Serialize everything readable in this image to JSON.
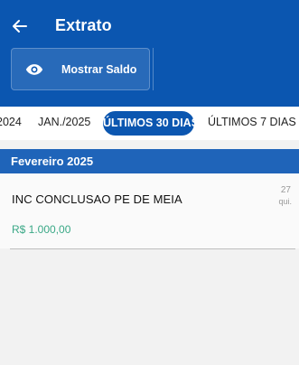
{
  "header": {
    "title": "Extrato",
    "back_icon": "arrow-left-icon",
    "background": "#0b56b0"
  },
  "saldo": {
    "label": "Mostrar Saldo",
    "icon": "eye-icon"
  },
  "period_tabs": {
    "items": [
      "2024",
      "JAN./2025",
      "ÚLTIMOS 30 DIAS",
      "ÚLTIMOS 7 DIAS"
    ],
    "selected": "ÚLTIMOS 30 DIAS"
  },
  "section": {
    "month": "Fevereiro 2025"
  },
  "transactions": [
    {
      "description": "INC CONCLUSAO PE DE MEIA",
      "amount": "R$ 1.000,00",
      "day": "27",
      "weekday": "qui.",
      "amount_color": "#3aa886"
    }
  ]
}
